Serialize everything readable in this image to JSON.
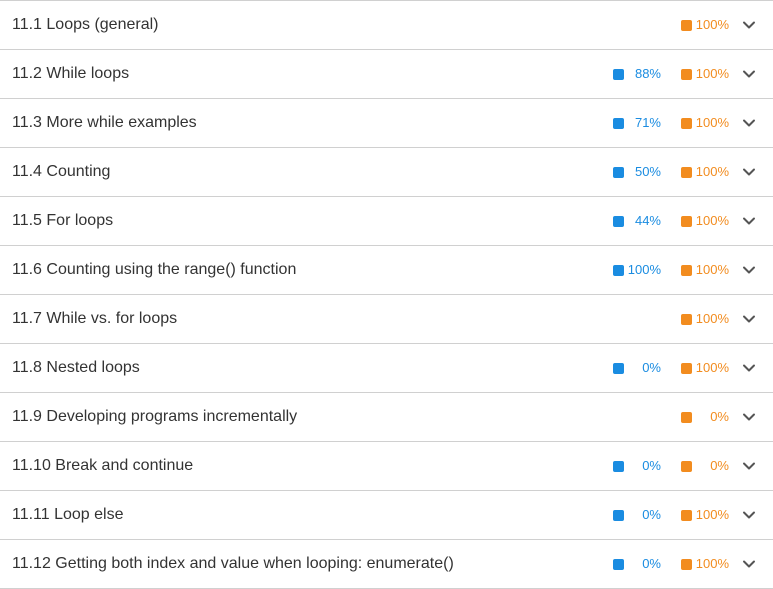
{
  "colors": {
    "participation": "#1a8ce1",
    "challenge": "#f28c1f",
    "text": "#333333",
    "divider": "#d0d0d0",
    "chevron": "#555555"
  },
  "icons": {
    "participation": "square-icon",
    "challenge": "square-icon",
    "expand": "chevron-down-icon"
  },
  "sections": [
    {
      "title": "11.1 Loops (general)",
      "participation": null,
      "challenge": "100%"
    },
    {
      "title": "11.2 While loops",
      "participation": "88%",
      "challenge": "100%"
    },
    {
      "title": "11.3 More while examples",
      "participation": "71%",
      "challenge": "100%"
    },
    {
      "title": "11.4 Counting",
      "participation": "50%",
      "challenge": "100%"
    },
    {
      "title": "11.5 For loops",
      "participation": "44%",
      "challenge": "100%"
    },
    {
      "title": "11.6 Counting using the range() function",
      "participation": "100%",
      "challenge": "100%"
    },
    {
      "title": "11.7 While vs. for loops",
      "participation": null,
      "challenge": "100%"
    },
    {
      "title": "11.8 Nested loops",
      "participation": "0%",
      "challenge": "100%"
    },
    {
      "title": "11.9 Developing programs incrementally",
      "participation": null,
      "challenge": "0%"
    },
    {
      "title": "11.10 Break and continue",
      "participation": "0%",
      "challenge": "0%"
    },
    {
      "title": "11.11 Loop else",
      "participation": "0%",
      "challenge": "100%"
    },
    {
      "title": "11.12 Getting both index and value when looping: enumerate()",
      "participation": "0%",
      "challenge": "100%"
    }
  ]
}
